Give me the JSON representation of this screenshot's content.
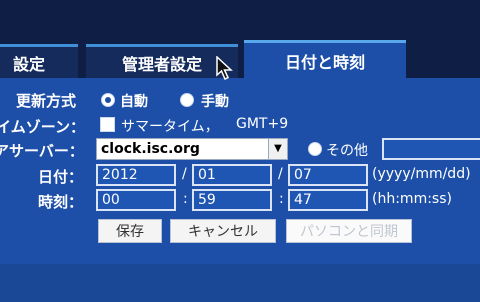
{
  "tabs": [
    {
      "label": "設定"
    },
    {
      "label": "管理者設定"
    },
    {
      "label": "日付と時刻"
    }
  ],
  "update_mode": {
    "label": "更新方式",
    "options": [
      {
        "label": "自動",
        "selected": true
      },
      {
        "label": "手動",
        "selected": false
      }
    ]
  },
  "timezone": {
    "label": "イムゾーン：",
    "dst_label": "サマータイム，",
    "zone": "GMT+9"
  },
  "server": {
    "label": "アサーバー：",
    "selected": "clock.isc.org",
    "other_label": "その他",
    "other_value": ""
  },
  "date": {
    "label": "日付：",
    "year": "2012",
    "month": "01",
    "day": "07",
    "sep": "/",
    "format": "(yyyy/mm/dd)"
  },
  "time": {
    "label": "時刻：",
    "hour": "00",
    "minute": "59",
    "second": "47",
    "sep": ":",
    "format": "(hh:mm:ss)"
  },
  "buttons": {
    "save": "保存",
    "cancel": "キャンセル",
    "sync_pc": "パソコンと同期"
  },
  "icons": {
    "arrow": "chevron-down-icon",
    "cursor": "mouse-pointer-icon"
  }
}
